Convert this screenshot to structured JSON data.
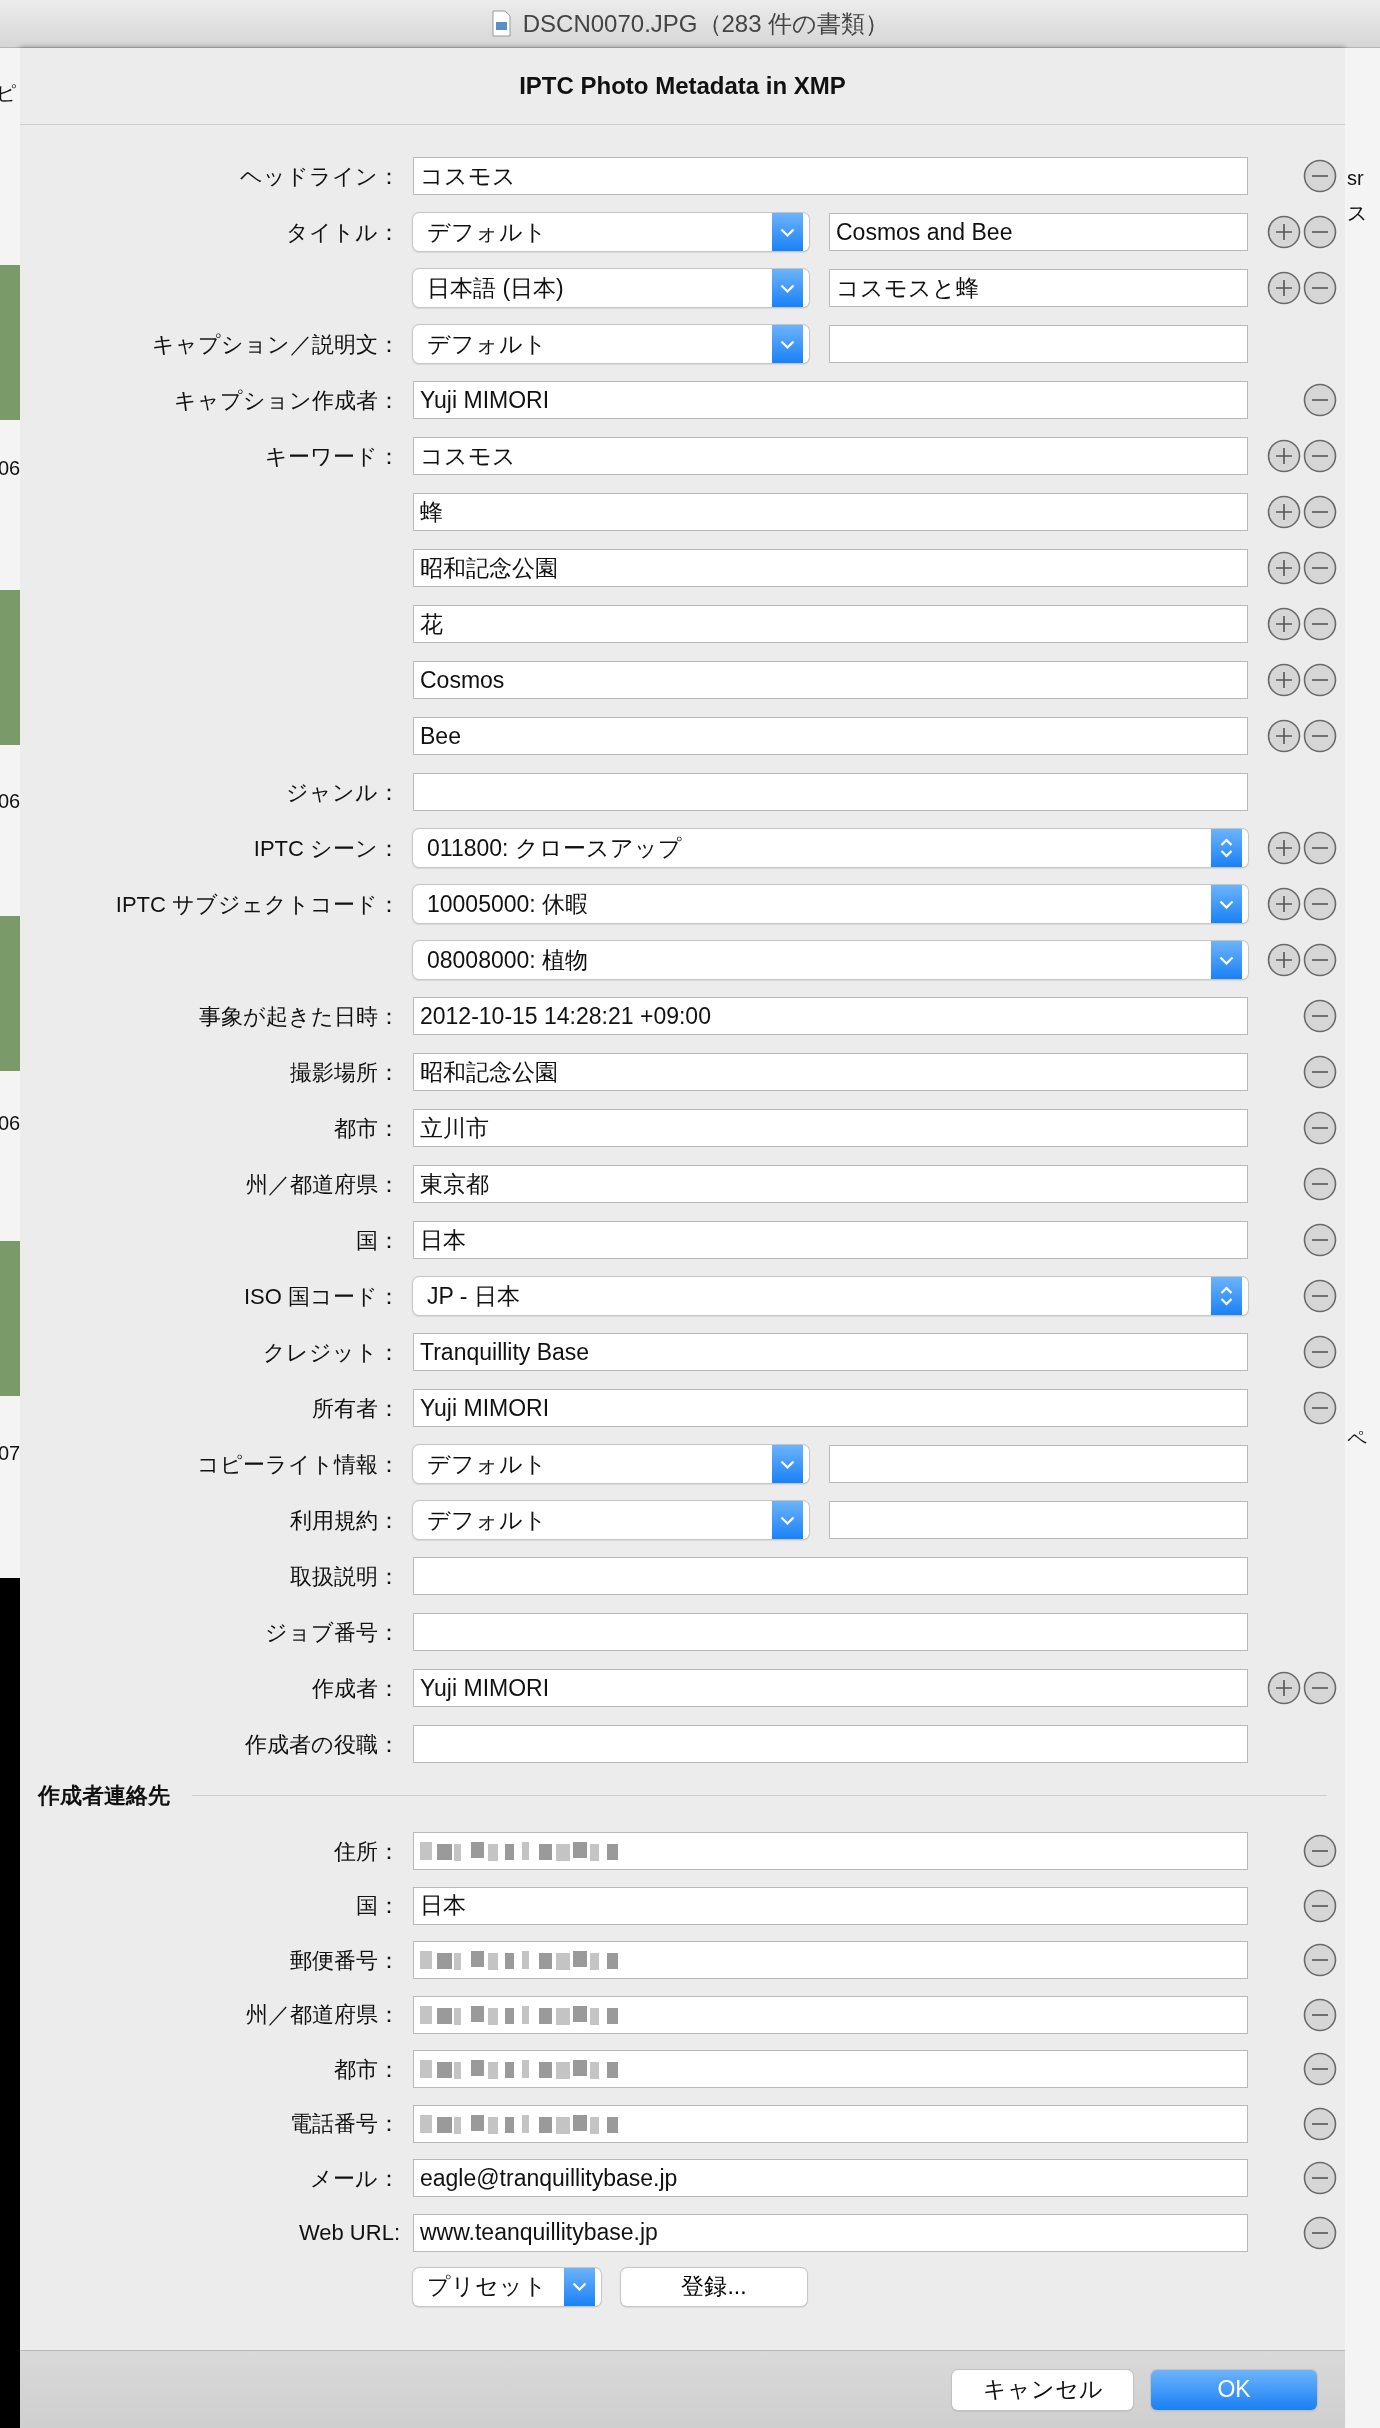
{
  "window": {
    "title": "DSCN0070.JPG（283 件の書類）"
  },
  "background_window": {
    "left_texts": [
      "ピ",
      "06",
      "06",
      "06",
      "07"
    ],
    "right_texts": [
      "sr",
      "ス",
      "ペ"
    ]
  },
  "dialog": {
    "title": "IPTC Photo Metadata in XMP",
    "fields": [
      {
        "label": "ヘッドライン：",
        "kind": "text",
        "value": "コスモス",
        "add": false,
        "remove": true
      },
      {
        "label": "タイトル：",
        "kind": "popup_text",
        "popup": "デフォルト",
        "value": "Cosmos and Bee",
        "add": true,
        "remove": true
      },
      {
        "kind": "popup_text",
        "popup": "日本語 (日本)",
        "value": "コスモスと蜂",
        "add": true,
        "remove": true
      },
      {
        "label": "キャプション／説明文：",
        "kind": "popup_text",
        "popup": "デフォルト",
        "add": false,
        "remove": false
      },
      {
        "label": "キャプション作成者：",
        "kind": "text",
        "value": "Yuji MIMORI",
        "add": false,
        "remove": true
      },
      {
        "label": "キーワード：",
        "kind": "text",
        "value": "コスモス",
        "add": true,
        "remove": true
      },
      {
        "kind": "text",
        "value": "蜂",
        "add": true,
        "remove": true
      },
      {
        "kind": "text",
        "value": "昭和記念公園",
        "add": true,
        "remove": true
      },
      {
        "kind": "text",
        "value": "花",
        "add": true,
        "remove": true
      },
      {
        "kind": "text",
        "value": "Cosmos",
        "add": true,
        "remove": true
      },
      {
        "kind": "text",
        "value": "Bee",
        "add": true,
        "remove": true
      },
      {
        "label": "ジャンル：",
        "kind": "text",
        "add": false,
        "remove": false
      },
      {
        "label": "IPTC シーン：",
        "kind": "stepper_select",
        "value": "011800: クロースアップ",
        "add": true,
        "remove": true
      },
      {
        "label": "IPTC サブジェクトコード：",
        "kind": "select",
        "value": "10005000: 休暇",
        "add": true,
        "remove": true
      },
      {
        "kind": "select",
        "value": "08008000: 植物",
        "add": true,
        "remove": true
      },
      {
        "label": "事象が起きた日時：",
        "kind": "text",
        "value": "2012-10-15 14:28:21 +09:00",
        "add": false,
        "remove": true
      },
      {
        "label": "撮影場所：",
        "kind": "text",
        "value": "昭和記念公園",
        "add": false,
        "remove": true
      },
      {
        "label": "都市：",
        "kind": "text",
        "value": "立川市",
        "add": false,
        "remove": true
      },
      {
        "label": "州／都道府県：",
        "kind": "text",
        "value": "東京都",
        "add": false,
        "remove": true
      },
      {
        "label": "国：",
        "kind": "text",
        "value": "日本",
        "add": false,
        "remove": true
      },
      {
        "label": "ISO 国コード：",
        "kind": "stepper_select",
        "value": "JP - 日本",
        "add": false,
        "remove": true
      },
      {
        "label": "クレジット：",
        "kind": "text",
        "value": "Tranquillity Base",
        "add": false,
        "remove": true
      },
      {
        "label": "所有者：",
        "kind": "text",
        "value": "Yuji MIMORI",
        "add": false,
        "remove": true
      },
      {
        "label": "コピーライト情報：",
        "kind": "popup_text",
        "popup": "デフォルト",
        "add": false,
        "remove": false
      },
      {
        "label": "利用規約：",
        "kind": "popup_text",
        "popup": "デフォルト",
        "add": false,
        "remove": false
      },
      {
        "label": "取扱説明：",
        "kind": "text",
        "add": false,
        "remove": false
      },
      {
        "label": "ジョブ番号：",
        "kind": "text",
        "add": false,
        "remove": false
      },
      {
        "label": "作成者：",
        "kind": "text",
        "value": "Yuji MIMORI",
        "add": true,
        "remove": true
      },
      {
        "label": "作成者の役職：",
        "kind": "text",
        "add": false,
        "remove": false
      }
    ],
    "contact_section": {
      "title": "作成者連絡先",
      "fields": [
        {
          "label": "住所：",
          "kind": "text",
          "redacted": true,
          "add": false,
          "remove": true
        },
        {
          "label": "国：",
          "kind": "text",
          "value": "日本",
          "add": false,
          "remove": true
        },
        {
          "label": "郵便番号：",
          "kind": "text",
          "redacted": true,
          "add": false,
          "remove": true
        },
        {
          "label": "州／都道府県：",
          "kind": "text",
          "redacted": true,
          "add": false,
          "remove": true
        },
        {
          "label": "都市：",
          "kind": "text",
          "redacted": true,
          "add": false,
          "remove": true
        },
        {
          "label": "電話番号：",
          "kind": "text",
          "redacted": true,
          "add": false,
          "remove": true
        },
        {
          "label": "メール：",
          "kind": "text",
          "value": "eagle@tranquillitybase.jp",
          "add": false,
          "remove": true
        },
        {
          "label": "Web URL:",
          "kind": "text",
          "value": "www.teanquillitybase.jp",
          "add": false,
          "remove": true
        }
      ]
    },
    "preset_menu": {
      "label": "プリセット"
    },
    "register_button": {
      "label": "登録..."
    },
    "buttons": [
      {
        "label": "キャンセル",
        "default": false
      },
      {
        "label": "OK",
        "default": true
      }
    ]
  }
}
